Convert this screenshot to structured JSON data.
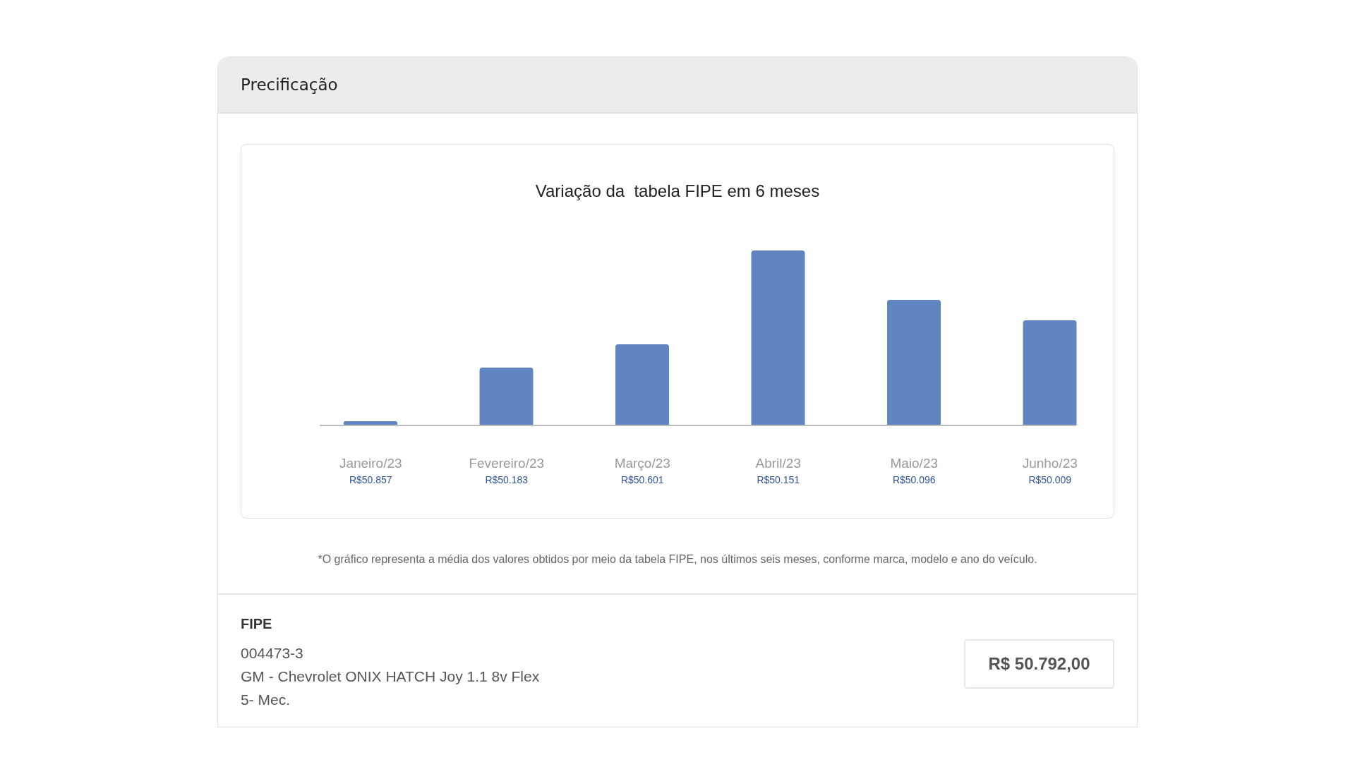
{
  "panel": {
    "title": "Precificação"
  },
  "chart": {
    "title": "Variação da  tabela FIPE em 6 meses",
    "months": [
      {
        "label": "Janeiro/23",
        "price": "R$50.857"
      },
      {
        "label": "Fevereiro/23",
        "price": "R$50.183"
      },
      {
        "label": "Março/23",
        "price": "R$50.601"
      },
      {
        "label": "Abril/23",
        "price": "R$50.151"
      },
      {
        "label": "Maio/23",
        "price": "R$50.096"
      },
      {
        "label": "Junho/23",
        "price": "R$50.009"
      }
    ]
  },
  "footnote": "*O gráfico representa a média dos valores obtidos por meio da tabela FIPE, nos últimos seis meses, conforme marca, modelo e ano do veículo.",
  "fipe": {
    "heading": "FIPE",
    "code": "004473-3",
    "model": "GM - Chevrolet ONIX HATCH Joy 1.1 8v Flex",
    "transmission": "5- Mec.",
    "price": "R$ 50.792,00"
  }
}
